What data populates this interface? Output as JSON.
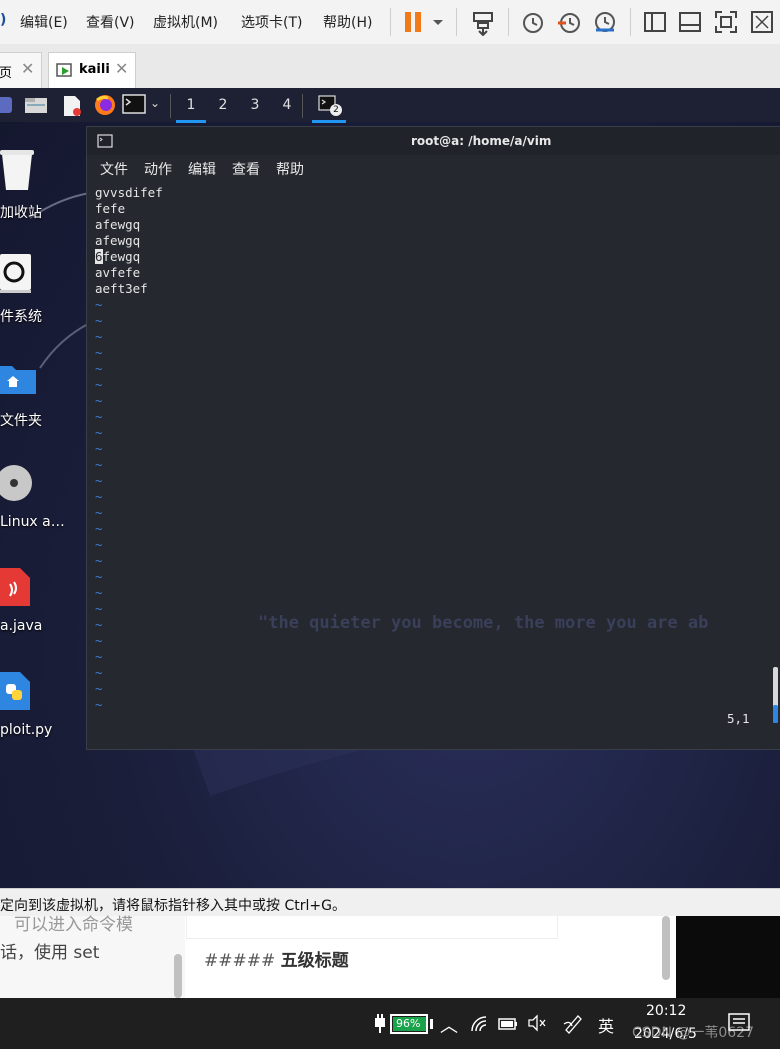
{
  "vmware": {
    "menu": [
      "编辑(E)",
      "查看(V)",
      "虚拟机(M)",
      "选项卡(T)",
      "帮助(H)"
    ],
    "first_menu_partial": ")"
  },
  "tabs": [
    {
      "label": "页",
      "active": false
    },
    {
      "label": "kaili",
      "active": true
    }
  ],
  "guest_panel": {
    "workspaces": [
      "1",
      "2",
      "3",
      "4"
    ],
    "terminal_badge": "2"
  },
  "desktop_icons": [
    {
      "label": "加收站",
      "icon": "trash-icon"
    },
    {
      "label": "件系统",
      "icon": "filesystem-icon"
    },
    {
      "label": "文件夹",
      "icon": "home-folder-icon"
    },
    {
      "label": "Linux a…",
      "icon": "disc-icon"
    },
    {
      "label": "a.java",
      "icon": "java-file-icon"
    },
    {
      "label": "ploit.py",
      "icon": "python-file-icon"
    }
  ],
  "terminal": {
    "title": "root@a: /home/a/vim",
    "menu": [
      "文件",
      "动作",
      "编辑",
      "查看",
      "帮助"
    ],
    "lines": [
      "gvvsdifef",
      "fefe",
      "afewgq",
      "afewgq",
      "6fewgq",
      "avfefe",
      "aeft3ef"
    ],
    "cursor_line_index": 4,
    "cursor_char": "6",
    "tilde_count": 26,
    "position": "5,1"
  },
  "wallpaper": {
    "slogan": "\"the quieter you become, the more you are ab"
  },
  "vm_status": {
    "message": "定向到该虚拟机，请将鼠标指针移入其中或按 Ctrl+G。"
  },
  "behind_window": {
    "left_text_1": "可以进入命令模",
    "left_text_2": "话，使用 set",
    "heading_marker": "#####",
    "heading_text": "五级标题"
  },
  "taskbar": {
    "battery": "96%",
    "ime": "英",
    "time": "20:12",
    "date": "2024/6/5",
    "watermark": "CSDN @一苇0627"
  }
}
